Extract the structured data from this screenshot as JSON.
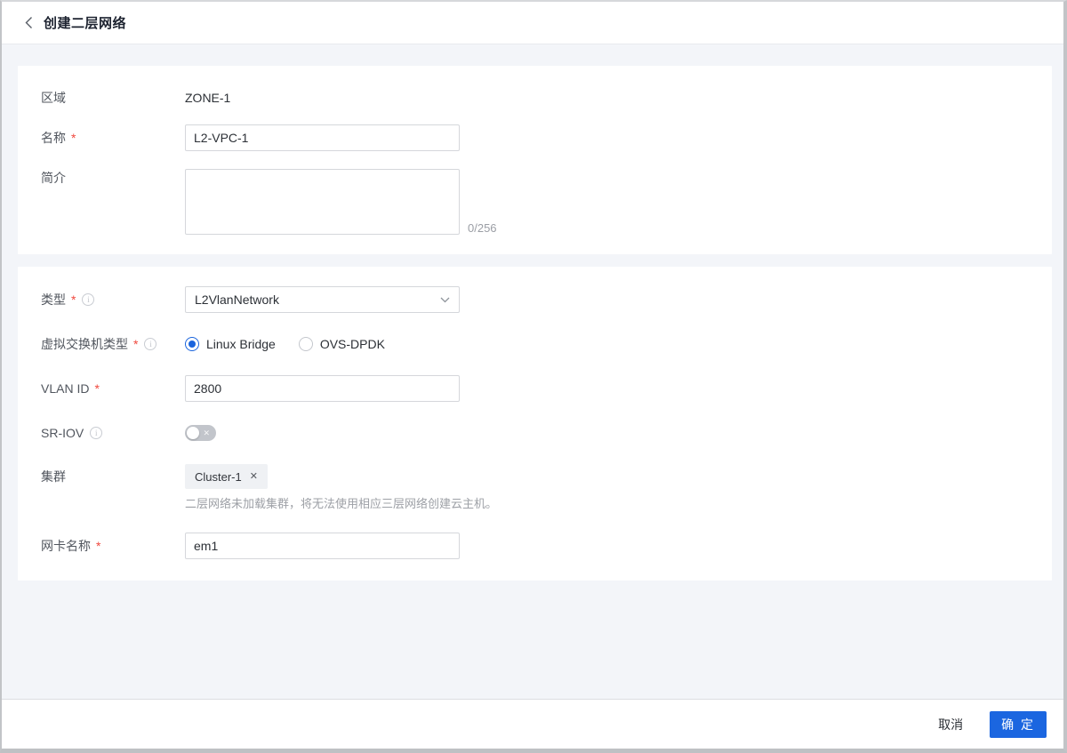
{
  "header": {
    "title": "创建二层网络"
  },
  "form": {
    "zone": {
      "label": "区域",
      "value": "ZONE-1"
    },
    "name": {
      "label": "名称",
      "required": "*",
      "value": "L2-VPC-1"
    },
    "description": {
      "label": "简介",
      "value": "",
      "counter": "0/256"
    },
    "type": {
      "label": "类型",
      "required": "*",
      "value": "L2VlanNetwork"
    },
    "vswitch": {
      "label": "虚拟交换机类型",
      "required": "*",
      "options": [
        {
          "label": "Linux Bridge",
          "selected": true
        },
        {
          "label": "OVS-DPDK",
          "selected": false
        }
      ]
    },
    "vlan": {
      "label": "VLAN ID",
      "required": "*",
      "value": "2800"
    },
    "sriov": {
      "label": "SR-IOV",
      "state": "off"
    },
    "cluster": {
      "label": "集群",
      "tag": "Cluster-1",
      "hint": "二层网络未加载集群，将无法使用相应三层网络创建云主机。"
    },
    "nic": {
      "label": "网卡名称",
      "required": "*",
      "value": "em1"
    }
  },
  "icons": {
    "info": "i",
    "tag_close": "✕",
    "toggle_off": "✕"
  },
  "footer": {
    "cancel": "取消",
    "confirm": "确 定"
  },
  "colors": {
    "accent": "#1b66e0",
    "required": "#f0483e",
    "page_bg": "#f3f5f9",
    "toggle_off_track": "#c2c5cb"
  }
}
